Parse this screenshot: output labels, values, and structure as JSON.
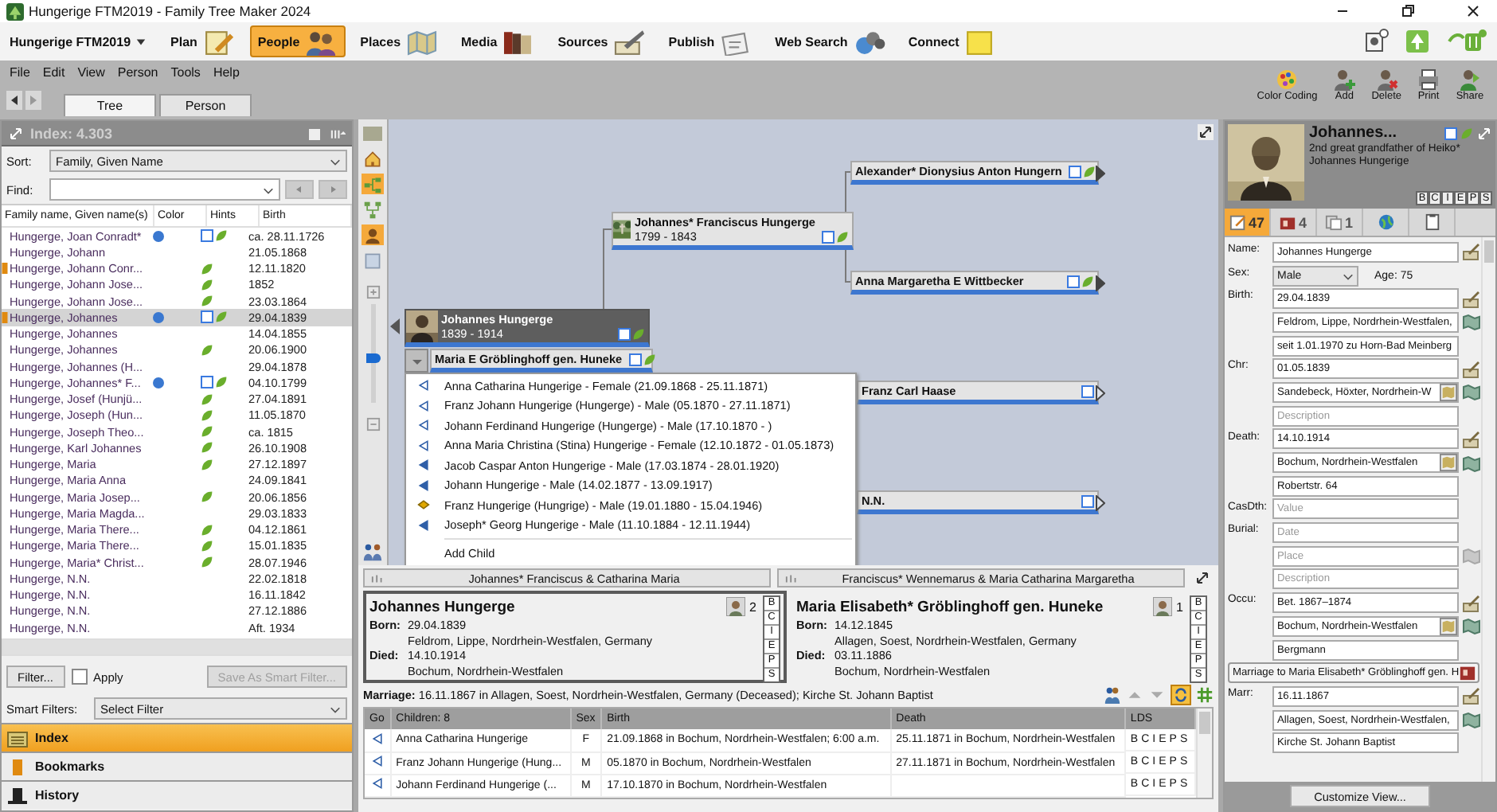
{
  "window": {
    "title": "Hungerige FTM2019 - Family Tree Maker 2024"
  },
  "nav": {
    "tree_menu": "Hungerige FTM2019",
    "items": [
      {
        "label": "Plan",
        "kind": "plan",
        "selected": false
      },
      {
        "label": "People",
        "kind": "people",
        "selected": true
      },
      {
        "label": "Places",
        "kind": "places",
        "selected": false
      },
      {
        "label": "Media",
        "kind": "media",
        "selected": false
      },
      {
        "label": "Sources",
        "kind": "sources",
        "selected": false
      },
      {
        "label": "Publish",
        "kind": "publish",
        "selected": false
      },
      {
        "label": "Web Search",
        "kind": "web",
        "selected": false
      },
      {
        "label": "Connect",
        "kind": "connect",
        "selected": false
      }
    ]
  },
  "menu": [
    "File",
    "Edit",
    "View",
    "Person",
    "Tools",
    "Help"
  ],
  "view_tabs": [
    {
      "label": "Tree",
      "selected": true
    },
    {
      "label": "Person",
      "selected": false
    }
  ],
  "actions": [
    {
      "label": "Color Coding",
      "kind": "palette"
    },
    {
      "label": "Add",
      "kind": "add"
    },
    {
      "label": "Delete",
      "kind": "delete"
    },
    {
      "label": "Print",
      "kind": "print"
    },
    {
      "label": "Share",
      "kind": "share"
    }
  ],
  "index": {
    "title": "Index: 4.303",
    "sort_label": "Sort:",
    "sort": "Family, Given Name",
    "find_label": "Find:",
    "columns": [
      "Family name, Given name(s)",
      "Color",
      "Hints",
      "Birth"
    ],
    "rows": [
      {
        "name": "Hungerge, Joan Conradt*",
        "birth": "ca. 28.11.1726",
        "selected": false,
        "bookmarked": false,
        "color": "#3a78d0",
        "record_hint": true,
        "leaf_hint": true
      },
      {
        "name": "Hungerge, Johann",
        "birth": "21.05.1868",
        "selected": false,
        "bookmarked": false,
        "record_hint": false,
        "leaf_hint": false
      },
      {
        "name": "Hungerge, Johann Conr...",
        "birth": "12.11.1820",
        "selected": false,
        "bookmarked": true,
        "record_hint": false,
        "leaf_hint": true
      },
      {
        "name": "Hungerge, Johann Jose...",
        "birth": "1852",
        "selected": false,
        "bookmarked": false,
        "record_hint": false,
        "leaf_hint": true
      },
      {
        "name": "Hungerge, Johann Jose...",
        "birth": "23.03.1864",
        "selected": false,
        "bookmarked": false,
        "record_hint": false,
        "leaf_hint": true
      },
      {
        "name": "Hungerge, Johannes",
        "birth": "29.04.1839",
        "selected": true,
        "bookmarked": true,
        "color": "#3a78d0",
        "record_hint": true,
        "leaf_hint": true
      },
      {
        "name": "Hungerge, Johannes",
        "birth": "14.04.1855",
        "selected": false,
        "bookmarked": false,
        "record_hint": false,
        "leaf_hint": false
      },
      {
        "name": "Hungerge, Johannes",
        "birth": "20.06.1900",
        "selected": false,
        "bookmarked": false,
        "record_hint": false,
        "leaf_hint": true
      },
      {
        "name": "Hungerge, Johannes (H...",
        "birth": "29.04.1878",
        "selected": false,
        "bookmarked": false,
        "record_hint": false,
        "leaf_hint": false
      },
      {
        "name": "Hungerge, Johannes* F...",
        "birth": "04.10.1799",
        "selected": false,
        "bookmarked": false,
        "color": "#3a78d0",
        "record_hint": true,
        "leaf_hint": true
      },
      {
        "name": "Hungerge, Josef (Hunjü...",
        "birth": "27.04.1891",
        "selected": false,
        "bookmarked": false,
        "record_hint": false,
        "leaf_hint": true
      },
      {
        "name": "Hungerge, Joseph (Hun...",
        "birth": "11.05.1870",
        "selected": false,
        "bookmarked": false,
        "record_hint": false,
        "leaf_hint": true
      },
      {
        "name": "Hungerge, Joseph Theo...",
        "birth": "ca. 1815",
        "selected": false,
        "bookmarked": false,
        "record_hint": false,
        "leaf_hint": true
      },
      {
        "name": "Hungerge, Karl Johannes",
        "birth": "26.10.1908",
        "selected": false,
        "bookmarked": false,
        "record_hint": false,
        "leaf_hint": true
      },
      {
        "name": "Hungerge, Maria",
        "birth": "27.12.1897",
        "selected": false,
        "bookmarked": false,
        "record_hint": false,
        "leaf_hint": true
      },
      {
        "name": "Hungerge, Maria Anna",
        "birth": "24.09.1841",
        "selected": false,
        "bookmarked": false,
        "record_hint": false,
        "leaf_hint": false
      },
      {
        "name": "Hungerge, Maria Josep...",
        "birth": "20.06.1856",
        "selected": false,
        "bookmarked": false,
        "record_hint": false,
        "leaf_hint": true
      },
      {
        "name": "Hungerge, Maria Magda...",
        "birth": "29.03.1833",
        "selected": false,
        "bookmarked": false,
        "record_hint": false,
        "leaf_hint": false
      },
      {
        "name": "Hungerge, Maria There...",
        "birth": "04.12.1861",
        "selected": false,
        "bookmarked": false,
        "record_hint": false,
        "leaf_hint": true
      },
      {
        "name": "Hungerge, Maria There...",
        "birth": "15.01.1835",
        "selected": false,
        "bookmarked": false,
        "record_hint": false,
        "leaf_hint": true
      },
      {
        "name": "Hungerge, Maria* Christ...",
        "birth": "28.07.1946",
        "selected": false,
        "bookmarked": false,
        "record_hint": false,
        "leaf_hint": true
      },
      {
        "name": "Hungerge, N.N.",
        "birth": "22.02.1818",
        "selected": false,
        "bookmarked": false,
        "record_hint": false,
        "leaf_hint": false
      },
      {
        "name": "Hungerge, N.N.",
        "birth": "16.11.1842",
        "selected": false,
        "bookmarked": false,
        "record_hint": false,
        "leaf_hint": false
      },
      {
        "name": "Hungerge, N.N.",
        "birth": "27.12.1886",
        "selected": false,
        "bookmarked": false,
        "record_hint": false,
        "leaf_hint": false
      },
      {
        "name": "Hungerge, N.N.",
        "birth": "Aft. 1934",
        "selected": false,
        "bookmarked": false,
        "record_hint": false,
        "leaf_hint": false
      }
    ],
    "filter": "Filter...",
    "apply": {
      "label": "Apply",
      "checked": false
    },
    "save_filter": {
      "label": "Save As Smart Filter...",
      "disabled": true
    },
    "smart_label": "Smart Filters:",
    "smart_value": "Select Filter"
  },
  "panels": [
    {
      "label": "Index",
      "kind": "index",
      "selected": true
    },
    {
      "label": "Bookmarks",
      "kind": "bookmarks",
      "selected": false
    },
    {
      "label": "History",
      "kind": "history",
      "selected": false
    }
  ],
  "tree": {
    "tools": [
      {
        "kind": "home",
        "selected": false
      },
      {
        "kind": "pedigree",
        "selected": true
      },
      {
        "kind": "descendants",
        "selected": false
      },
      {
        "kind": "person",
        "selected": true
      },
      {
        "kind": "blank",
        "selected": false
      }
    ],
    "zoom": {
      "level": 0.45
    },
    "focus": {
      "name": "Johannes Hungerge",
      "years": "1839 - 1914",
      "record_hint": true,
      "leaf_hint": true
    },
    "spouse": {
      "name": "Maria E Gröblinghoff gen. Huneke",
      "record_hint": true,
      "leaf_hint": true
    },
    "father": {
      "name": "Johannes* Franciscus Hungerge",
      "years": "1799 - 1843",
      "record_hint": true,
      "leaf_hint": true
    },
    "ancestors": [
      {
        "name": "Alexander* Dionysius Anton Hungern",
        "record_hint": true,
        "leaf_hint": true,
        "has_parents": true
      },
      {
        "name": "Anna Margaretha E Wittbecker",
        "record_hint": true,
        "leaf_hint": true,
        "has_parents": true
      },
      {
        "name": "Franz Carl Haase",
        "record_hint": true,
        "leaf_hint": false,
        "has_parents": false
      },
      {
        "name": "N.N.",
        "record_hint": true,
        "leaf_hint": false,
        "has_parents": false
      }
    ],
    "children_menu": {
      "items": [
        {
          "label": "Anna Catharina Hungerige - Female (21.09.1868 - 25.11.1871)",
          "kind": "hollow"
        },
        {
          "label": "Franz Johann Hungerige (Hungerge) - Male (05.1870 - 27.11.1871)",
          "kind": "hollow"
        },
        {
          "label": "Johann Ferdinand Hungerige (Hungerge) - Male (17.10.1870 - )",
          "kind": "hollow"
        },
        {
          "label": "Anna Maria Christina (Stina) Hungerige - Female (12.10.1872 - 01.05.1873)",
          "kind": "hollow"
        },
        {
          "label": "Jacob Caspar Anton Hungerige - Male (17.03.1874 - 28.01.1920)",
          "kind": "filled"
        },
        {
          "label": "Johann Hungerige - Male (14.02.1877 - 13.09.1917)",
          "kind": "filled"
        },
        {
          "label": "Franz Hungerige (Hungrige) - Male (19.01.1880 - 15.04.1946)",
          "kind": "diamond"
        },
        {
          "label": "Joseph* Georg Hungerige - Male (11.10.1884 - 12.11.1944)",
          "kind": "filled"
        }
      ],
      "add": "Add Child"
    }
  },
  "family": {
    "tabs": [
      "Johannes* Franciscus & Catharina Maria",
      "Franciscus* Wennemarus & Maria Catharina Margaretha"
    ],
    "partners": [
      {
        "name": "Johannes Hungerge",
        "selected": true,
        "media_count": "2",
        "facts": [
          {
            "label": "Born:",
            "date": "29.04.1839",
            "place": "Feldrom, Lippe, Nordrhein-Westfalen, Germany"
          },
          {
            "label": "Died:",
            "date": "14.10.1914",
            "place": "Bochum, Nordrhein-Westfalen"
          }
        ],
        "lds": [
          "B",
          "C",
          "I",
          "E",
          "P",
          "S"
        ]
      },
      {
        "name": "Maria Elisabeth* Gröblinghoff gen. Huneke",
        "selected": false,
        "media_count": "1",
        "facts": [
          {
            "label": "Born:",
            "date": "14.12.1845",
            "place": "Allagen, Soest, Nordrhein-Westfalen, Germany"
          },
          {
            "label": "Died:",
            "date": "03.11.1886",
            "place": "Bochum, Nordrhein-Westfalen"
          }
        ],
        "lds": [
          "B",
          "C",
          "I",
          "E",
          "P",
          "S"
        ]
      }
    ],
    "marriage_label": "Marriage:",
    "marriage": "16.11.1867 in Allagen, Soest, Nordrhein-Westfalen, Germany (Deceased); Kirche St. Johann Baptist"
  },
  "children": {
    "columns": [
      "Go",
      "Children: 8",
      "Sex",
      "Birth",
      "Death",
      "LDS"
    ],
    "rows": [
      {
        "kind": "hollow",
        "name": "Anna Catharina Hungerige",
        "sex": "F",
        "birth": "21.09.1868 in Bochum, Nordrhein-Westfalen; 6:00 a.m.",
        "death": "25.11.1871 in Bochum, Nordrhein-Westfalen",
        "lds": [
          "B",
          "C",
          "I",
          "E",
          "P",
          "S"
        ]
      },
      {
        "kind": "hollow",
        "name": "Franz Johann Hungerige (Hung...",
        "sex": "M",
        "birth": "05.1870 in Bochum, Nordrhein-Westfalen",
        "death": "27.11.1871 in Bochum, Nordrhein-Westfalen",
        "lds": [
          "B",
          "C",
          "I",
          "E",
          "P",
          "S"
        ]
      },
      {
        "kind": "hollow",
        "name": "Johann Ferdinand Hungerige (...",
        "sex": "M",
        "birth": "17.10.1870 in Bochum, Nordrhein-Westfalen",
        "lds": [
          "B",
          "C",
          "I",
          "E",
          "P",
          "S"
        ]
      }
    ]
  },
  "person": {
    "name": "Johannes...",
    "relation": "2nd great grandfather of Heiko* Johannes Hungerige",
    "record_hint": true,
    "leaf_hint": true,
    "lds": [
      "B",
      "C",
      "I",
      "E",
      "P",
      "S"
    ],
    "tabs": [
      {
        "label": "47",
        "kind": "facts",
        "selected": true
      },
      {
        "label": "4",
        "kind": "relatives",
        "selected": false
      },
      {
        "label": "1",
        "kind": "media",
        "selected": false
      },
      {
        "kind": "web",
        "selected": false
      },
      {
        "kind": "notes",
        "selected": false
      }
    ],
    "fields": [
      {
        "kind": "fact",
        "label": "Name:",
        "lines": [
          {
            "value": "Johannes Hungerge",
            "kind": "source"
          }
        ]
      },
      {
        "kind": "select",
        "label": "Sex:",
        "value": "Male",
        "note": "Age: 75"
      },
      {
        "kind": "fact",
        "label": "Birth:",
        "lines": [
          {
            "value": "29.04.1839",
            "kind": "source"
          },
          {
            "value": "Feldrom, Lippe, Nordrhein-Westfalen,",
            "kind": "map"
          },
          {
            "value": "seit 1.01.1970 zu Horn-Bad Meinberg"
          }
        ]
      },
      {
        "kind": "fact",
        "label": "Chr:",
        "lines": [
          {
            "value": "01.05.1839",
            "kind": "source"
          },
          {
            "value": "Sandebeck, Höxter, Nordrhein-W",
            "kind": "map",
            "lookup": true
          },
          {
            "placeholder": "Description"
          }
        ]
      },
      {
        "kind": "fact",
        "label": "Death:",
        "lines": [
          {
            "value": "14.10.1914",
            "kind": "source"
          },
          {
            "value": "Bochum, Nordrhein-Westfalen",
            "kind": "map",
            "lookup": true
          },
          {
            "value": "Robertstr. 64"
          }
        ]
      },
      {
        "kind": "fact",
        "label": "CasDth:",
        "lines": [
          {
            "placeholder": "Value"
          }
        ]
      },
      {
        "kind": "fact",
        "label": "Burial:",
        "lines": [
          {
            "placeholder": "Date"
          },
          {
            "placeholder": "Place",
            "kind": "map",
            "disabled": true
          },
          {
            "placeholder": "Description"
          }
        ]
      },
      {
        "kind": "fact",
        "label": "Occu:",
        "lines": [
          {
            "value": "Bet. 1867–1874",
            "kind": "source"
          },
          {
            "value": "Bochum, Nordrhein-Westfalen",
            "kind": "map",
            "lookup": true
          },
          {
            "value": "Bergmann"
          }
        ]
      },
      {
        "kind": "relationship",
        "value": "Marriage to Maria Elisabeth* Gröblinghoff gen. H"
      },
      {
        "kind": "fact",
        "label": "Marr:",
        "lines": [
          {
            "value": "16.11.1867",
            "kind": "source"
          },
          {
            "value": "Allagen, Soest, Nordrhein-Westfalen,",
            "kind": "map"
          },
          {
            "value": "Kirche St. Johann Baptist"
          }
        ]
      }
    ],
    "customize": "Customize View..."
  }
}
